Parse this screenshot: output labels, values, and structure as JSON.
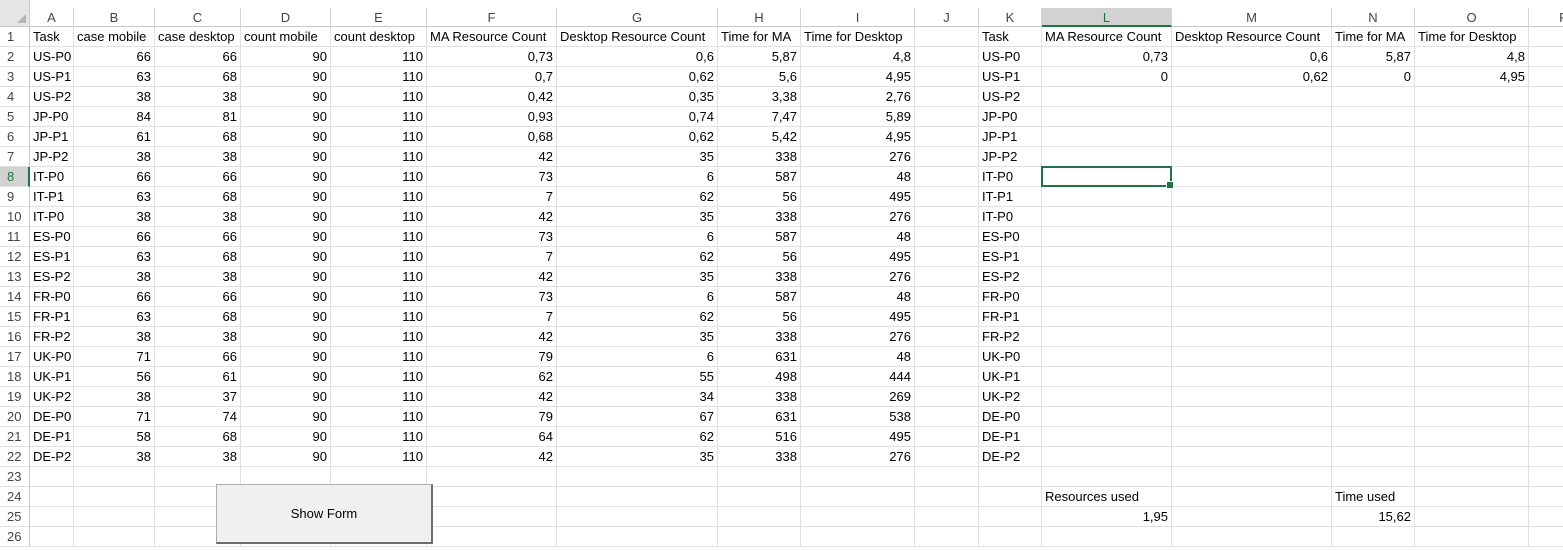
{
  "columns": [
    {
      "letter": "A",
      "width": 44
    },
    {
      "letter": "B",
      "width": 81
    },
    {
      "letter": "C",
      "width": 86
    },
    {
      "letter": "D",
      "width": 90
    },
    {
      "letter": "E",
      "width": 96
    },
    {
      "letter": "F",
      "width": 130
    },
    {
      "letter": "G",
      "width": 161
    },
    {
      "letter": "H",
      "width": 83
    },
    {
      "letter": "I",
      "width": 114
    },
    {
      "letter": "J",
      "width": 64
    },
    {
      "letter": "K",
      "width": 63
    },
    {
      "letter": "L",
      "width": 130
    },
    {
      "letter": "M",
      "width": 160
    },
    {
      "letter": "N",
      "width": 83
    },
    {
      "letter": "O",
      "width": 114
    },
    {
      "letter": "P",
      "width": 70
    }
  ],
  "selected_cell": {
    "col": "L",
    "row": 8
  },
  "rows": [
    {
      "n": 1,
      "cells": {
        "A": "Task",
        "B": "case mobile",
        "C": "case desktop",
        "D": "count mobile",
        "E": "count desktop",
        "F": "MA Resource Count",
        "G": "Desktop Resource Count",
        "H": "Time for MA",
        "I": "Time for Desktop",
        "K": "Task",
        "L": "MA Resource Count",
        "M": "Desktop Resource Count",
        "N": "Time for MA",
        "O": "Time for Desktop"
      }
    },
    {
      "n": 2,
      "cells": {
        "A": "US-P0",
        "B": "66",
        "C": "66",
        "D": "90",
        "E": "110",
        "F": "0,73",
        "G": "0,6",
        "H": "5,87",
        "I": "4,8",
        "K": "US-P0",
        "L": "0,73",
        "M": "0,6",
        "N": "5,87",
        "O": "4,8"
      }
    },
    {
      "n": 3,
      "cells": {
        "A": "US-P1",
        "B": "63",
        "C": "68",
        "D": "90",
        "E": "110",
        "F": "0,7",
        "G": "0,62",
        "H": "5,6",
        "I": "4,95",
        "K": "US-P1",
        "L": "0",
        "M": "0,62",
        "N": "0",
        "O": "4,95"
      }
    },
    {
      "n": 4,
      "cells": {
        "A": "US-P2",
        "B": "38",
        "C": "38",
        "D": "90",
        "E": "110",
        "F": "0,42",
        "G": "0,35",
        "H": "3,38",
        "I": "2,76",
        "K": "US-P2"
      }
    },
    {
      "n": 5,
      "cells": {
        "A": "JP-P0",
        "B": "84",
        "C": "81",
        "D": "90",
        "E": "110",
        "F": "0,93",
        "G": "0,74",
        "H": "7,47",
        "I": "5,89",
        "K": "JP-P0"
      }
    },
    {
      "n": 6,
      "cells": {
        "A": "JP-P1",
        "B": "61",
        "C": "68",
        "D": "90",
        "E": "110",
        "F": "0,68",
        "G": "0,62",
        "H": "5,42",
        "I": "4,95",
        "K": "JP-P1"
      }
    },
    {
      "n": 7,
      "cells": {
        "A": "JP-P2",
        "B": "38",
        "C": "38",
        "D": "90",
        "E": "110",
        "F": "42",
        "G": "35",
        "H": "338",
        "I": "276",
        "K": "JP-P2"
      }
    },
    {
      "n": 8,
      "cells": {
        "A": "IT-P0",
        "B": "66",
        "C": "66",
        "D": "90",
        "E": "110",
        "F": "73",
        "G": "6",
        "H": "587",
        "I": "48",
        "K": "IT-P0"
      }
    },
    {
      "n": 9,
      "cells": {
        "A": "IT-P1",
        "B": "63",
        "C": "68",
        "D": "90",
        "E": "110",
        "F": "7",
        "G": "62",
        "H": "56",
        "I": "495",
        "K": "IT-P1"
      }
    },
    {
      "n": 10,
      "cells": {
        "A": "IT-P0",
        "B": "38",
        "C": "38",
        "D": "90",
        "E": "110",
        "F": "42",
        "G": "35",
        "H": "338",
        "I": "276",
        "K": "IT-P0"
      }
    },
    {
      "n": 11,
      "cells": {
        "A": "ES-P0",
        "B": "66",
        "C": "66",
        "D": "90",
        "E": "110",
        "F": "73",
        "G": "6",
        "H": "587",
        "I": "48",
        "K": "ES-P0"
      }
    },
    {
      "n": 12,
      "cells": {
        "A": "ES-P1",
        "B": "63",
        "C": "68",
        "D": "90",
        "E": "110",
        "F": "7",
        "G": "62",
        "H": "56",
        "I": "495",
        "K": "ES-P1"
      }
    },
    {
      "n": 13,
      "cells": {
        "A": "ES-P2",
        "B": "38",
        "C": "38",
        "D": "90",
        "E": "110",
        "F": "42",
        "G": "35",
        "H": "338",
        "I": "276",
        "K": "ES-P2"
      }
    },
    {
      "n": 14,
      "cells": {
        "A": "FR-P0",
        "B": "66",
        "C": "66",
        "D": "90",
        "E": "110",
        "F": "73",
        "G": "6",
        "H": "587",
        "I": "48",
        "K": "FR-P0"
      }
    },
    {
      "n": 15,
      "cells": {
        "A": "FR-P1",
        "B": "63",
        "C": "68",
        "D": "90",
        "E": "110",
        "F": "7",
        "G": "62",
        "H": "56",
        "I": "495",
        "K": "FR-P1"
      }
    },
    {
      "n": 16,
      "cells": {
        "A": "FR-P2",
        "B": "38",
        "C": "38",
        "D": "90",
        "E": "110",
        "F": "42",
        "G": "35",
        "H": "338",
        "I": "276",
        "K": "FR-P2"
      }
    },
    {
      "n": 17,
      "cells": {
        "A": "UK-P0",
        "B": "71",
        "C": "66",
        "D": "90",
        "E": "110",
        "F": "79",
        "G": "6",
        "H": "631",
        "I": "48",
        "K": "UK-P0"
      }
    },
    {
      "n": 18,
      "cells": {
        "A": "UK-P1",
        "B": "56",
        "C": "61",
        "D": "90",
        "E": "110",
        "F": "62",
        "G": "55",
        "H": "498",
        "I": "444",
        "K": "UK-P1"
      }
    },
    {
      "n": 19,
      "cells": {
        "A": "UK-P2",
        "B": "38",
        "C": "37",
        "D": "90",
        "E": "110",
        "F": "42",
        "G": "34",
        "H": "338",
        "I": "269",
        "K": "UK-P2"
      }
    },
    {
      "n": 20,
      "cells": {
        "A": "DE-P0",
        "B": "71",
        "C": "74",
        "D": "90",
        "E": "110",
        "F": "79",
        "G": "67",
        "H": "631",
        "I": "538",
        "K": "DE-P0"
      }
    },
    {
      "n": 21,
      "cells": {
        "A": "DE-P1",
        "B": "58",
        "C": "68",
        "D": "90",
        "E": "110",
        "F": "64",
        "G": "62",
        "H": "516",
        "I": "495",
        "K": "DE-P1"
      }
    },
    {
      "n": 22,
      "cells": {
        "A": "DE-P2",
        "B": "38",
        "C": "38",
        "D": "90",
        "E": "110",
        "F": "42",
        "G": "35",
        "H": "338",
        "I": "276",
        "K": "DE-P2"
      }
    },
    {
      "n": 23,
      "cells": {}
    },
    {
      "n": 24,
      "cells": {
        "L": "Resources used",
        "N": "Time used"
      }
    },
    {
      "n": 25,
      "cells": {
        "L": "1,95",
        "N": "15,62"
      }
    },
    {
      "n": 26,
      "cells": {}
    }
  ],
  "button": {
    "label": "Show Form"
  },
  "colors": {
    "accent": "#217346"
  }
}
